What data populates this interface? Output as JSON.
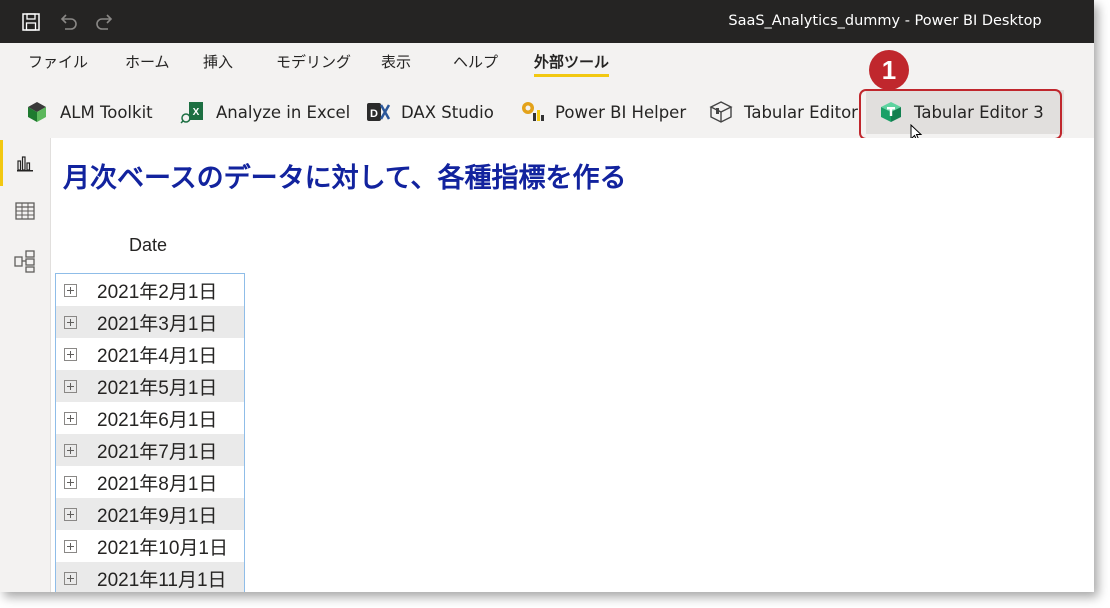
{
  "window": {
    "title": "SaaS_Analytics_dummy - Power BI Desktop"
  },
  "menu_tabs": [
    {
      "label": "ファイル",
      "active": false
    },
    {
      "label": "ホーム",
      "active": false
    },
    {
      "label": "挿入",
      "active": false
    },
    {
      "label": "モデリング",
      "active": false
    },
    {
      "label": "表示",
      "active": false
    },
    {
      "label": "ヘルプ",
      "active": false
    },
    {
      "label": "外部ツール",
      "active": true
    }
  ],
  "external_tools": [
    {
      "label": "ALM Toolkit",
      "icon": "alm-toolkit-icon"
    },
    {
      "label": "Analyze in Excel",
      "icon": "excel-icon"
    },
    {
      "label": "DAX Studio",
      "icon": "dax-studio-icon"
    },
    {
      "label": "Power BI Helper",
      "icon": "power-bi-helper-icon"
    },
    {
      "label": "Tabular Editor",
      "icon": "tabular-editor-icon"
    },
    {
      "label": "Tabular Editor 3",
      "icon": "tabular-editor-3-icon"
    }
  ],
  "annotation": {
    "step_number": "1"
  },
  "page": {
    "title": "月次ベースのデータに対して、各種指標を作る",
    "table_header": "Date",
    "rows": [
      "2021年2月1日",
      "2021年3月1日",
      "2021年4月1日",
      "2021年5月1日",
      "2021年6月1日",
      "2021年7月1日",
      "2021年8月1日",
      "2021年9月1日",
      "2021年10月1日",
      "2021年11月1日"
    ]
  },
  "colors": {
    "titlebar": "#252423",
    "ribbon": "#f3f2f1",
    "accent_yellow": "#f2c811",
    "highlight_red": "#c0272d",
    "page_title": "#12239e"
  }
}
